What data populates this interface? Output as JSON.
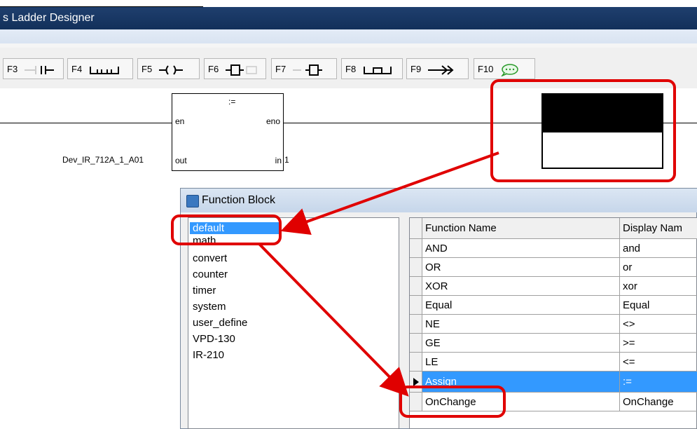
{
  "window": {
    "title": "s Ladder Designer"
  },
  "toolbar": {
    "buttons": [
      {
        "key": "F3"
      },
      {
        "key": "F4"
      },
      {
        "key": "F5"
      },
      {
        "key": "F6"
      },
      {
        "key": "F7"
      },
      {
        "key": "F8"
      },
      {
        "key": "F9"
      },
      {
        "key": "F10"
      }
    ]
  },
  "ladder": {
    "block": {
      "op": ":=",
      "en": "en",
      "eno": "eno",
      "out": "out",
      "in": "in"
    },
    "out_var": "Dev_IR_712A_1_A01",
    "in_value": "1"
  },
  "dialog": {
    "title": "Function Block",
    "categories": [
      "default",
      "math",
      "convert",
      "counter",
      "timer",
      "system",
      "user_define",
      "VPD-130",
      "IR-210"
    ],
    "selected_category": "default",
    "columns": [
      "Function Name",
      "Display Nam"
    ],
    "rows": [
      {
        "name": "AND",
        "display": "and"
      },
      {
        "name": "OR",
        "display": "or"
      },
      {
        "name": "XOR",
        "display": "xor"
      },
      {
        "name": "Equal",
        "display": "Equal"
      },
      {
        "name": "NE",
        "display": "<>"
      },
      {
        "name": "GE",
        "display": ">="
      },
      {
        "name": "LE",
        "display": "<="
      },
      {
        "name": "Assign",
        "display": ":="
      },
      {
        "name": "OnChange",
        "display": "OnChange"
      }
    ],
    "selected_row": "Assign"
  },
  "colors": {
    "title_bar": "#1f3f6e",
    "selection": "#3399ff",
    "highlight_annotation": "#e00000"
  }
}
